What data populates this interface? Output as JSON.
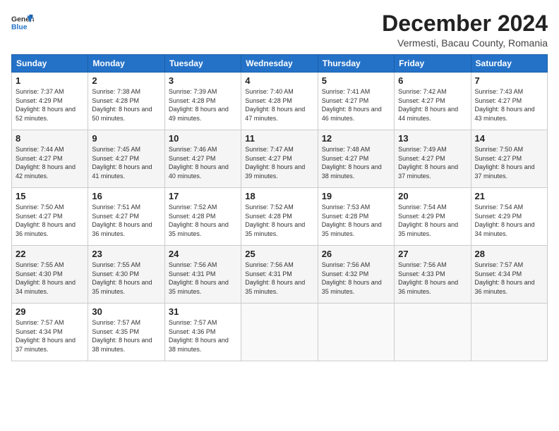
{
  "header": {
    "logo_line1": "General",
    "logo_line2": "Blue",
    "month_year": "December 2024",
    "location": "Vermesti, Bacau County, Romania"
  },
  "weekdays": [
    "Sunday",
    "Monday",
    "Tuesday",
    "Wednesday",
    "Thursday",
    "Friday",
    "Saturday"
  ],
  "weeks": [
    [
      {
        "day": "1",
        "sunrise": "7:37 AM",
        "sunset": "4:29 PM",
        "daylight": "8 hours and 52 minutes."
      },
      {
        "day": "2",
        "sunrise": "7:38 AM",
        "sunset": "4:28 PM",
        "daylight": "8 hours and 50 minutes."
      },
      {
        "day": "3",
        "sunrise": "7:39 AM",
        "sunset": "4:28 PM",
        "daylight": "8 hours and 49 minutes."
      },
      {
        "day": "4",
        "sunrise": "7:40 AM",
        "sunset": "4:28 PM",
        "daylight": "8 hours and 47 minutes."
      },
      {
        "day": "5",
        "sunrise": "7:41 AM",
        "sunset": "4:27 PM",
        "daylight": "8 hours and 46 minutes."
      },
      {
        "day": "6",
        "sunrise": "7:42 AM",
        "sunset": "4:27 PM",
        "daylight": "8 hours and 44 minutes."
      },
      {
        "day": "7",
        "sunrise": "7:43 AM",
        "sunset": "4:27 PM",
        "daylight": "8 hours and 43 minutes."
      }
    ],
    [
      {
        "day": "8",
        "sunrise": "7:44 AM",
        "sunset": "4:27 PM",
        "daylight": "8 hours and 42 minutes."
      },
      {
        "day": "9",
        "sunrise": "7:45 AM",
        "sunset": "4:27 PM",
        "daylight": "8 hours and 41 minutes."
      },
      {
        "day": "10",
        "sunrise": "7:46 AM",
        "sunset": "4:27 PM",
        "daylight": "8 hours and 40 minutes."
      },
      {
        "day": "11",
        "sunrise": "7:47 AM",
        "sunset": "4:27 PM",
        "daylight": "8 hours and 39 minutes."
      },
      {
        "day": "12",
        "sunrise": "7:48 AM",
        "sunset": "4:27 PM",
        "daylight": "8 hours and 38 minutes."
      },
      {
        "day": "13",
        "sunrise": "7:49 AM",
        "sunset": "4:27 PM",
        "daylight": "8 hours and 37 minutes."
      },
      {
        "day": "14",
        "sunrise": "7:50 AM",
        "sunset": "4:27 PM",
        "daylight": "8 hours and 37 minutes."
      }
    ],
    [
      {
        "day": "15",
        "sunrise": "7:50 AM",
        "sunset": "4:27 PM",
        "daylight": "8 hours and 36 minutes."
      },
      {
        "day": "16",
        "sunrise": "7:51 AM",
        "sunset": "4:27 PM",
        "daylight": "8 hours and 36 minutes."
      },
      {
        "day": "17",
        "sunrise": "7:52 AM",
        "sunset": "4:28 PM",
        "daylight": "8 hours and 35 minutes."
      },
      {
        "day": "18",
        "sunrise": "7:52 AM",
        "sunset": "4:28 PM",
        "daylight": "8 hours and 35 minutes."
      },
      {
        "day": "19",
        "sunrise": "7:53 AM",
        "sunset": "4:28 PM",
        "daylight": "8 hours and 35 minutes."
      },
      {
        "day": "20",
        "sunrise": "7:54 AM",
        "sunset": "4:29 PM",
        "daylight": "8 hours and 35 minutes."
      },
      {
        "day": "21",
        "sunrise": "7:54 AM",
        "sunset": "4:29 PM",
        "daylight": "8 hours and 34 minutes."
      }
    ],
    [
      {
        "day": "22",
        "sunrise": "7:55 AM",
        "sunset": "4:30 PM",
        "daylight": "8 hours and 34 minutes."
      },
      {
        "day": "23",
        "sunrise": "7:55 AM",
        "sunset": "4:30 PM",
        "daylight": "8 hours and 35 minutes."
      },
      {
        "day": "24",
        "sunrise": "7:56 AM",
        "sunset": "4:31 PM",
        "daylight": "8 hours and 35 minutes."
      },
      {
        "day": "25",
        "sunrise": "7:56 AM",
        "sunset": "4:31 PM",
        "daylight": "8 hours and 35 minutes."
      },
      {
        "day": "26",
        "sunrise": "7:56 AM",
        "sunset": "4:32 PM",
        "daylight": "8 hours and 35 minutes."
      },
      {
        "day": "27",
        "sunrise": "7:56 AM",
        "sunset": "4:33 PM",
        "daylight": "8 hours and 36 minutes."
      },
      {
        "day": "28",
        "sunrise": "7:57 AM",
        "sunset": "4:34 PM",
        "daylight": "8 hours and 36 minutes."
      }
    ],
    [
      {
        "day": "29",
        "sunrise": "7:57 AM",
        "sunset": "4:34 PM",
        "daylight": "8 hours and 37 minutes."
      },
      {
        "day": "30",
        "sunrise": "7:57 AM",
        "sunset": "4:35 PM",
        "daylight": "8 hours and 38 minutes."
      },
      {
        "day": "31",
        "sunrise": "7:57 AM",
        "sunset": "4:36 PM",
        "daylight": "8 hours and 38 minutes."
      },
      null,
      null,
      null,
      null
    ]
  ]
}
